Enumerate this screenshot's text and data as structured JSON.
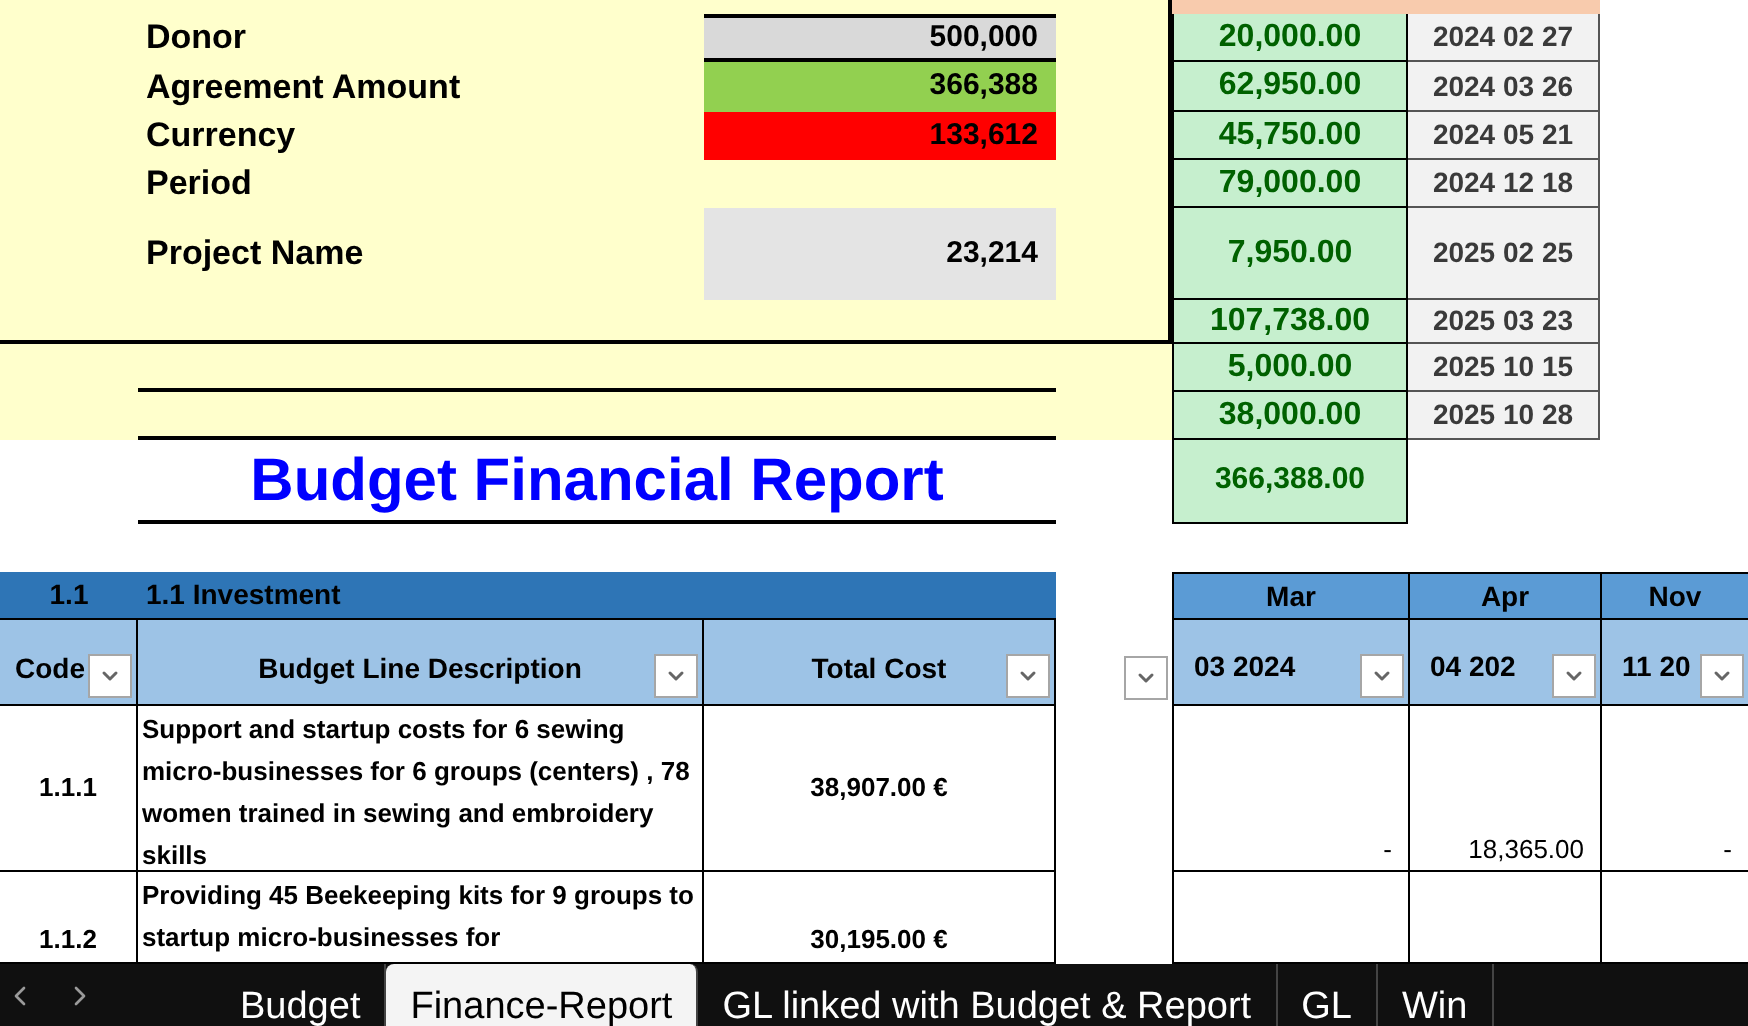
{
  "summary": [
    {
      "label": "Donor",
      "value": "500,000",
      "color": "#d9d9d9"
    },
    {
      "label": "Agreement Amount",
      "value": "366,388",
      "color": "#92d050"
    },
    {
      "label": "Currency",
      "value": "133,612",
      "color": "#ff0000"
    },
    {
      "label": "Period"
    },
    {
      "label": "Project Name",
      "value": "23,214",
      "color": "#e4e4e4"
    }
  ],
  "payments": [
    {
      "amount": "20,000.00",
      "date": "2024 02 27"
    },
    {
      "amount": "62,950.00",
      "date": "2024 03 26"
    },
    {
      "amount": "45,750.00",
      "date": "2024 05 21"
    },
    {
      "amount": "79,000.00",
      "date": "2024 12 18"
    },
    {
      "amount": "7,950.00",
      "date": "2025 02 25"
    },
    {
      "amount": "107,738.00",
      "date": "2025 03 23"
    },
    {
      "amount": "5,000.00",
      "date": "2025 10 15"
    },
    {
      "amount": "38,000.00",
      "date": "2025 10 28"
    }
  ],
  "payments_total": "366,388.00",
  "title": "Budget Financial Report",
  "section": {
    "code": "1.1",
    "title": "1.1 Investment"
  },
  "columns": [
    "Code",
    "Budget Line Description",
    "Total Cost"
  ],
  "months": [
    {
      "name": "Mar",
      "period": "03 2024"
    },
    {
      "name": "Apr",
      "period": "04 202"
    },
    {
      "name": "Nov",
      "period": "11 20"
    }
  ],
  "rows": [
    {
      "code": "1.1.1",
      "description": "Support and startup costs for 6 sewing micro-businesses for 6 groups (centers) , 78 women trained in sewing and embroidery skills",
      "total": "38,907.00 €",
      "months": [
        "-",
        "18,365.00",
        "-"
      ]
    },
    {
      "code": "1.1.2",
      "description": "Providing 45 Beekeeping kits for 9 groups to  startup  micro-businesses for",
      "total": "30,195.00 €"
    }
  ],
  "tabs": [
    {
      "label": "Budget",
      "selected": false
    },
    {
      "label": "Finance-Report",
      "selected": true
    },
    {
      "label": "GL linked with Budget & Report",
      "selected": false
    },
    {
      "label": "GL",
      "selected": false
    },
    {
      "label": "Win",
      "selected": false
    }
  ]
}
